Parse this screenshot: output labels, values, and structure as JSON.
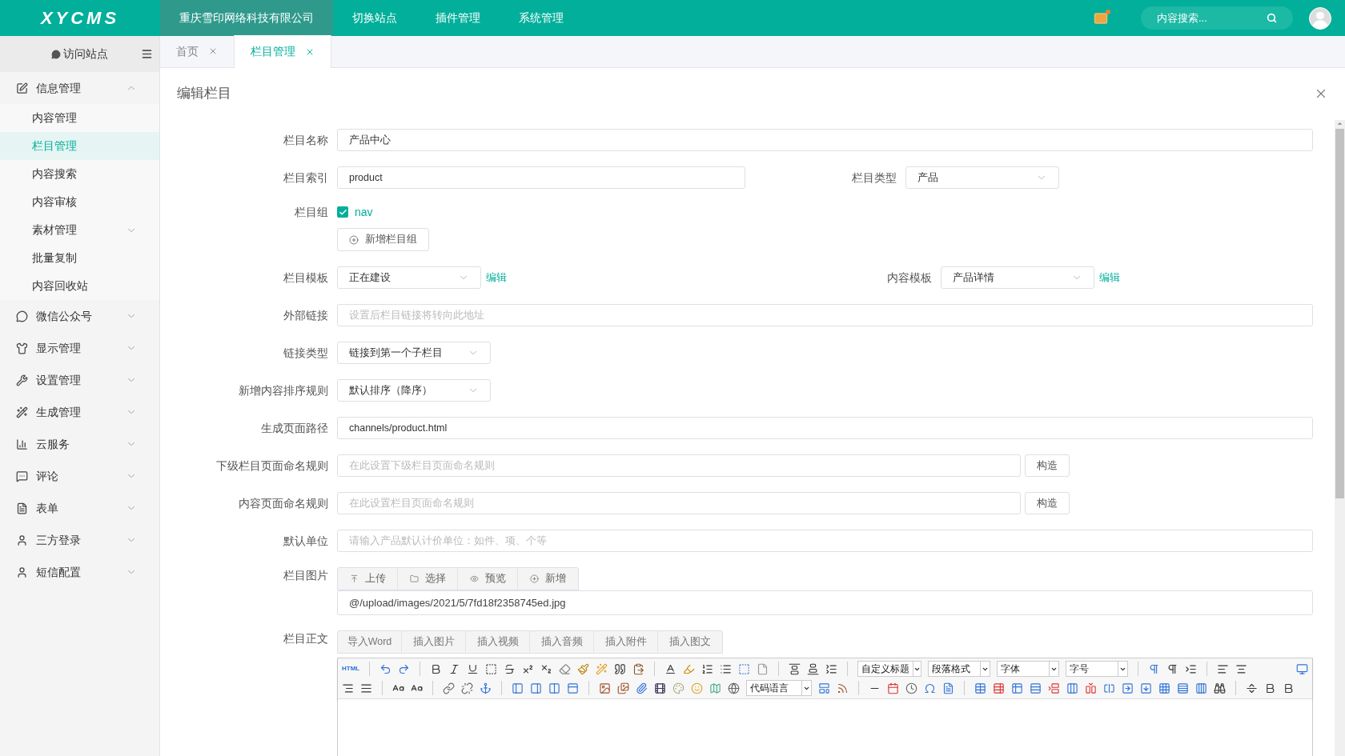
{
  "topbar": {
    "logo": "XYCMS",
    "nav": [
      {
        "label": "重庆雪印网络科技有限公司",
        "selected": true
      },
      {
        "label": "切换站点",
        "selected": false
      },
      {
        "label": "插件管理",
        "selected": false
      },
      {
        "label": "系统管理",
        "selected": false
      }
    ],
    "search": {
      "placeholder": "内容搜索..."
    },
    "mail_unread": true
  },
  "sidebar": {
    "visit_site": "访问站点",
    "groups": [
      {
        "label": "信息管理",
        "expanded": true,
        "children": [
          {
            "label": "内容管理",
            "selected": false
          },
          {
            "label": "栏目管理",
            "selected": true
          },
          {
            "label": "内容搜索",
            "selected": false
          },
          {
            "label": "内容审核",
            "selected": false
          },
          {
            "label": "素材管理",
            "selected": false,
            "expanded": false
          },
          {
            "label": "批量复制",
            "selected": false
          },
          {
            "label": "内容回收站",
            "selected": false
          }
        ]
      },
      {
        "label": "微信公众号",
        "expanded": false
      },
      {
        "label": "显示管理",
        "expanded": false
      },
      {
        "label": "设置管理",
        "expanded": false
      },
      {
        "label": "生成管理",
        "expanded": false
      },
      {
        "label": "云服务",
        "expanded": false
      },
      {
        "label": "评论",
        "expanded": false
      },
      {
        "label": "表单",
        "expanded": false
      },
      {
        "label": "三方登录",
        "expanded": false
      },
      {
        "label": "短信配置",
        "expanded": false
      }
    ]
  },
  "tabs": [
    {
      "label": "首页",
      "selected": false
    },
    {
      "label": "栏目管理",
      "selected": true
    }
  ],
  "panel": {
    "title": "编辑栏目",
    "form": {
      "name": {
        "label": "栏目名称",
        "value": "产品中心"
      },
      "index": {
        "label": "栏目索引",
        "value": "product"
      },
      "type": {
        "label": "栏目类型",
        "value": "产品"
      },
      "group": {
        "label": "栏目组",
        "options": [
          {
            "label": "nav",
            "checked": true
          }
        ],
        "add_button": "新增栏目组"
      },
      "template": {
        "label": "栏目模板",
        "value": "正在建设",
        "link": "编辑"
      },
      "content_template": {
        "label": "内容模板",
        "value": "产品详情",
        "link": "编辑"
      },
      "external_link": {
        "label": "外部链接",
        "placeholder": "设置后栏目链接将转向此地址"
      },
      "link_type": {
        "label": "链接类型",
        "value": "链接到第一个子栏目"
      },
      "sort_rule": {
        "label": "新增内容排序规则",
        "value": "默认排序（降序）"
      },
      "page_path": {
        "label": "生成页面路径",
        "value": "channels/product.html"
      },
      "child_naming": {
        "label": "下级栏目页面命名规则",
        "placeholder": "在此设置下级栏目页面命名规则",
        "button": "构造"
      },
      "content_naming": {
        "label": "内容页面命名规则",
        "placeholder": "在此设置栏目页面命名规则",
        "button": "构造"
      },
      "default_unit": {
        "label": "默认单位",
        "placeholder": "请输入产品默认计价单位：如件、项、个等"
      },
      "image": {
        "label": "栏目图片",
        "buttons": [
          "上传",
          "选择",
          "预览",
          "新增"
        ],
        "value": "@/upload/images/2021/5/7fd18f2358745ed.jpg"
      },
      "body": {
        "label": "栏目正文",
        "buttons": [
          "导入Word",
          "插入图片",
          "插入视频",
          "插入音频",
          "插入附件",
          "插入图文"
        ],
        "toolbar": {
          "html_label": "HTML",
          "heading_selects": [
            "自定义标题",
            "段落格式",
            "字体",
            "字号"
          ],
          "code_select": "代码语言"
        }
      }
    }
  }
}
